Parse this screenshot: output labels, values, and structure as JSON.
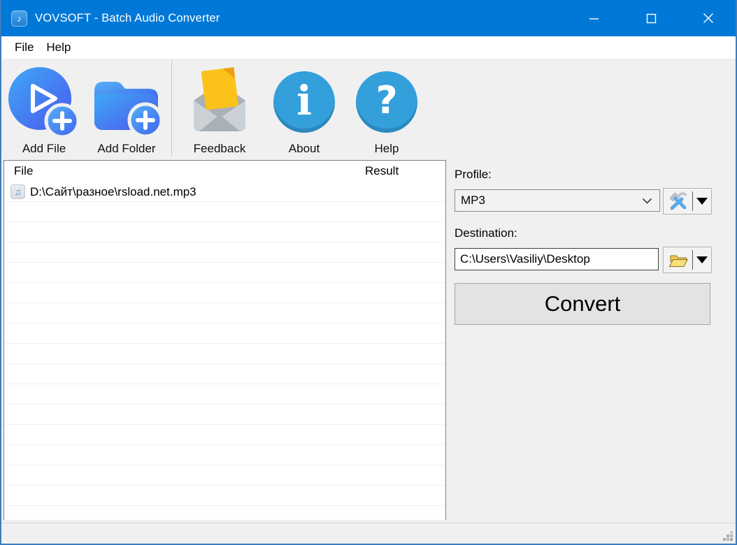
{
  "window": {
    "title": "VOVSOFT - Batch Audio Converter",
    "app_icon": "music-file-app-icon",
    "app_icon_glyph": "♪"
  },
  "menu": {
    "items": [
      {
        "label": "File"
      },
      {
        "label": "Help"
      }
    ]
  },
  "toolbar": {
    "items": [
      {
        "label": "Add File",
        "icon": "add-file-icon"
      },
      {
        "label": "Add Folder",
        "icon": "add-folder-icon"
      },
      {
        "label": "Feedback",
        "icon": "feedback-envelope-icon"
      },
      {
        "label": "About",
        "icon": "about-info-icon",
        "glyph": "i"
      },
      {
        "label": "Help",
        "icon": "help-question-icon",
        "glyph": "?"
      }
    ]
  },
  "file_table": {
    "columns": [
      "File",
      "Result"
    ],
    "rows": [
      {
        "icon": "audio-file-icon",
        "icon_glyph": "♫",
        "file": "D:\\Сайт\\разное\\rsload.net.mp3",
        "result": ""
      }
    ]
  },
  "profile": {
    "label": "Profile:",
    "selected": "MP3",
    "edit_button_icon": "tools-icon"
  },
  "destination": {
    "label": "Destination:",
    "value": "C:\\Users\\Vasiliy\\Desktop",
    "browse_button_icon": "open-folder-icon"
  },
  "convert_label": "Convert",
  "colors": {
    "titlebar": "#0078d7",
    "window_border": "#3a7ebf",
    "toolbar_bg": "#f0f0f0",
    "icon_gradient_start": "#3fa9f5",
    "icon_gradient_end": "#4b57ee",
    "flat_icon_blue": "#33a0dc",
    "envelope_yellow": "#fbc21a",
    "folder_yellow": "#f7e07a"
  }
}
